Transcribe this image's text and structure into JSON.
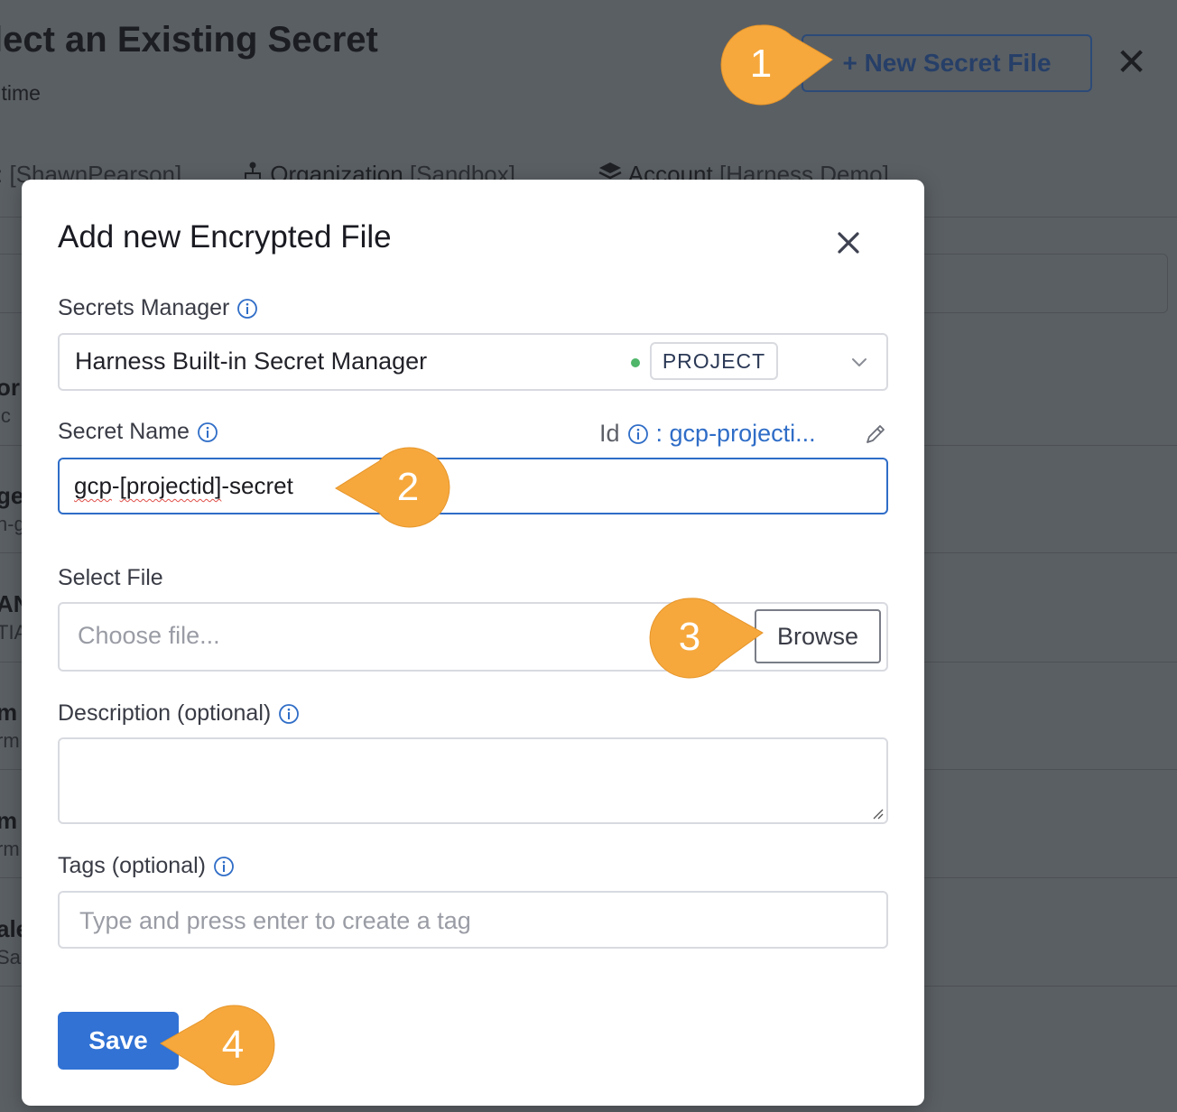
{
  "background": {
    "title": "lect an Existing Secret",
    "subtitle": "l time",
    "new_secret_button": "+ New Secret File",
    "close_glyph": "✕",
    "scopes": [
      {
        "label": "",
        "detail": "[ShawnPearson]"
      },
      {
        "label": "Organization",
        "detail": "[Sandbox]"
      },
      {
        "label": "Account",
        "detail": "[Harness Demo]"
      }
    ],
    "row_fragments": [
      {
        "primary": "or",
        "secondary": "lc"
      },
      {
        "primary": "ge",
        "secondary": "n-g"
      },
      {
        "primary": "AN",
        "secondary": "TIA"
      },
      {
        "primary": "m",
        "secondary": "rm"
      },
      {
        "primary": "m",
        "secondary": "rm"
      },
      {
        "primary": "ale",
        "secondary": "Sa"
      }
    ]
  },
  "modal": {
    "title": "Add new Encrypted File",
    "secrets_manager": {
      "label": "Secrets Manager",
      "value": "Harness Built-in Secret Manager",
      "scope_badge": "PROJECT",
      "status_color": "#4fb66a"
    },
    "secret_name": {
      "label": "Secret Name",
      "id_label": "Id",
      "id_value": ": gcp-projecti...",
      "value_parts": [
        "gcp",
        "-",
        "[projectid]",
        "-secret"
      ]
    },
    "select_file": {
      "label": "Select File",
      "placeholder": "Choose file...",
      "browse_label": "Browse"
    },
    "description": {
      "label": "Description (optional)",
      "value": ""
    },
    "tags": {
      "label": "Tags (optional)",
      "placeholder": "Type and press enter to create a tag"
    },
    "save_label": "Save"
  },
  "callouts": [
    "1",
    "2",
    "3",
    "4"
  ],
  "colors": {
    "accent": "#3172d4",
    "callout": "#f6a83c",
    "link": "#2f6dc7"
  }
}
